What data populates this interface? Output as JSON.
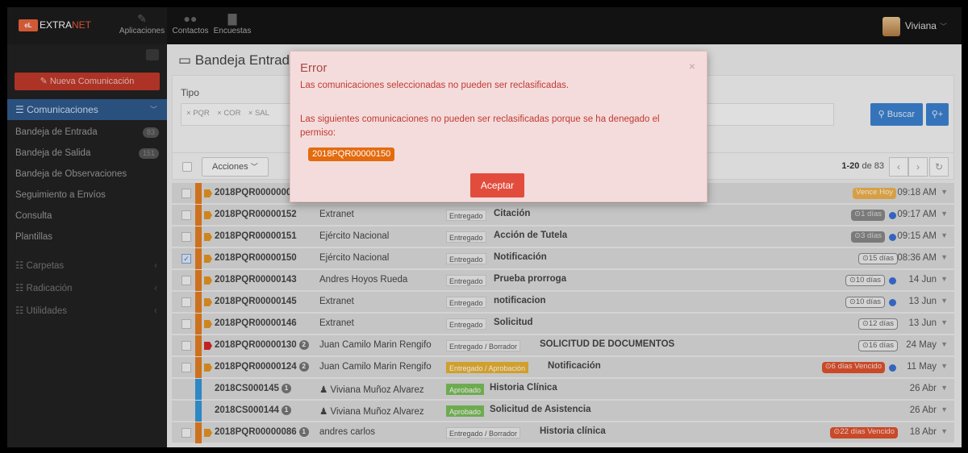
{
  "navbar": {
    "brand_prefix": "EXTRA",
    "brand_suffix": "NET",
    "logo_text": "eL",
    "items": [
      {
        "label": "Aplicaciones",
        "icon": "pencil-icon"
      },
      {
        "label": "Contactos",
        "icon": "people-icon"
      },
      {
        "label": "Encuestas",
        "icon": "document-icon"
      }
    ],
    "user_name": "Viviana"
  },
  "sidebar": {
    "new_button": "Nueva Comunicación",
    "section": "Comunicaciones",
    "items": [
      {
        "label": "Bandeja de Entrada",
        "badge": "83"
      },
      {
        "label": "Bandeja de Salida",
        "badge": "151"
      },
      {
        "label": "Bandeja de Observaciones",
        "badge": ""
      },
      {
        "label": "Seguimiento a Envíos",
        "badge": ""
      },
      {
        "label": "Consulta",
        "badge": ""
      },
      {
        "label": "Plantillas",
        "badge": ""
      }
    ],
    "groups": [
      "Carpetas",
      "Radicación",
      "Utilidades"
    ]
  },
  "main": {
    "title": "Bandeja Entrad",
    "filter_label": "Tipo",
    "tags": [
      "PQR",
      "COR",
      "SAL"
    ],
    "search_button": "Buscar",
    "actions_button": "Acciones",
    "pager_range": "1-20",
    "pager_of": "de 83"
  },
  "rows": [
    {
      "num": "2018PQR00000152",
      "count": "",
      "from": "Extranet",
      "state": "Entregado",
      "state_style": "plain",
      "subject": "Citación",
      "due": "1 días",
      "due_style": "grey",
      "dot": true,
      "date": "09:17 AM",
      "checked": false,
      "type": "PQR",
      "flag": "orange"
    },
    {
      "num": "2018PQR00000151",
      "count": "",
      "from": "Ejército Nacional",
      "state": "Entregado",
      "state_style": "plain",
      "subject": "Acción de Tutela",
      "due": "3 días",
      "due_style": "grey",
      "dot": true,
      "date": "09:15 AM",
      "checked": false,
      "type": "PQR",
      "flag": "orange"
    },
    {
      "num": "2018PQR00000150",
      "count": "",
      "from": "Ejército Nacional",
      "state": "Entregado",
      "state_style": "plain",
      "subject": "Notificación",
      "due": "15 días",
      "due_style": "out",
      "dot": false,
      "date": "08:36 AM",
      "checked": true,
      "type": "PQR",
      "flag": "orange"
    },
    {
      "num": "2018PQR00000143",
      "count": "",
      "from": "Andres Hoyos Rueda",
      "state": "Entregado",
      "state_style": "plain",
      "subject": "Prueba prorroga",
      "due": "10 días",
      "due_style": "out",
      "dot": true,
      "date": "14 Jun",
      "checked": false,
      "type": "PQR",
      "flag": "orange"
    },
    {
      "num": "2018PQR00000145",
      "count": "",
      "from": "Extranet",
      "state": "Entregado",
      "state_style": "plain",
      "subject": "notificacion",
      "due": "10 días",
      "due_style": "out",
      "dot": true,
      "date": "13 Jun",
      "checked": false,
      "type": "PQR",
      "flag": "orange"
    },
    {
      "num": "2018PQR00000146",
      "count": "",
      "from": "Extranet",
      "state": "Entregado",
      "state_style": "plain",
      "subject": "Solicitud",
      "due": "12 días",
      "due_style": "out",
      "dot": false,
      "date": "13 Jun",
      "checked": false,
      "type": "PQR",
      "flag": "orange"
    },
    {
      "num": "2018PQR00000130",
      "count": "2",
      "from": "Juan Camilo Marin Rengifo",
      "state": "Entregado / Borrador",
      "state_style": "plain",
      "subject": "SOLICITUD DE DOCUMENTOS",
      "due": "16 días",
      "due_style": "out",
      "dot": false,
      "date": "24 May",
      "checked": false,
      "type": "PQR",
      "flag": "red"
    },
    {
      "num": "2018PQR00000124",
      "count": "2",
      "from": "Juan Camilo Marin Rengifo",
      "state": "Entregado / Aprobación",
      "state_style": "yellow",
      "subject": "Notificación",
      "due": "6 días Vencido",
      "due_style": "red",
      "dot": true,
      "date": "11 May",
      "checked": false,
      "type": "PQR",
      "flag": "orange"
    },
    {
      "num": "2018CS000145",
      "count": "1",
      "from": "Viviana Muñoz Alvarez",
      "state": "Aprobado",
      "state_style": "green",
      "subject": "Historia Clínica",
      "due": "",
      "due_style": "",
      "dot": false,
      "date": "26 Abr",
      "checked": false,
      "type": "SAL",
      "flag": "none"
    },
    {
      "num": "2018CS000144",
      "count": "1",
      "from": "Viviana Muñoz Alvarez",
      "state": "Aprobado",
      "state_style": "green",
      "subject": "Solicitud de Asistencia",
      "due": "",
      "due_style": "",
      "dot": false,
      "date": "26 Abr",
      "checked": false,
      "type": "SAL",
      "flag": "none"
    },
    {
      "num": "2018PQR00000086",
      "count": "1",
      "from": "andres carlos",
      "state": "Entregado / Borrador",
      "state_style": "plain",
      "subject": "Historia clínica",
      "due": "22 días Vencido",
      "due_style": "red",
      "dot": false,
      "date": "18 Abr",
      "checked": false,
      "type": "PQR",
      "flag": "orange"
    }
  ],
  "first_row": {
    "num": "2018PQR00000001",
    "due": "Vence Hoy",
    "date": "09:18 AM"
  },
  "modal": {
    "title": "Error",
    "close": "×",
    "message1": "Las comunicaciones seleccionadas no pueden ser reclasificadas.",
    "message2": "Las siguientes comunicaciones no pueden ser reclasificadas porque se ha denegado el permiso:",
    "item": "2018PQR00000150",
    "button": "Aceptar"
  }
}
